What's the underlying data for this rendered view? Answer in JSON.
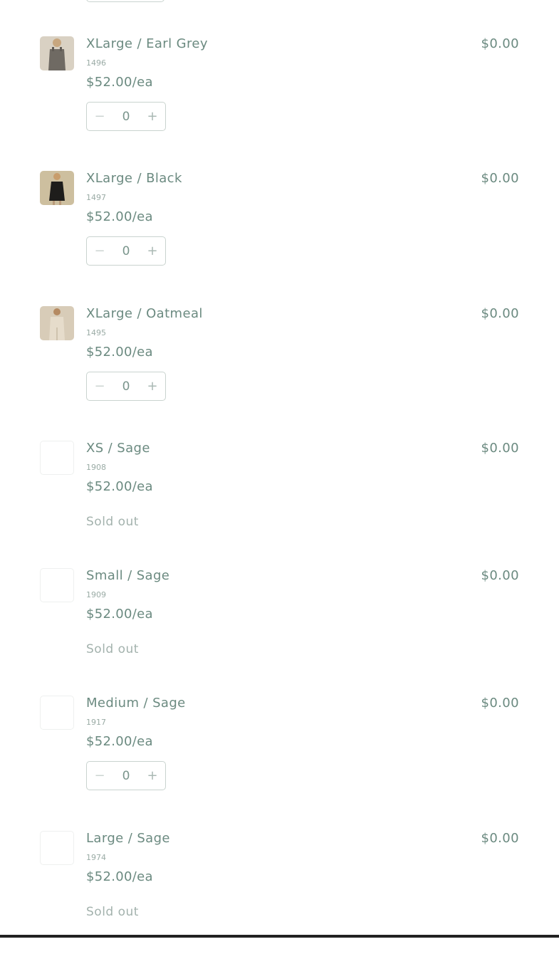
{
  "items": [
    {
      "name": "XLarge / Earl Grey",
      "sku": "1496",
      "unit_price": "$52.00/ea",
      "total": "$0.00",
      "quantity": "0",
      "sold_out": false,
      "thumb": "earl-grey"
    },
    {
      "name": "XLarge / Black",
      "sku": "1497",
      "unit_price": "$52.00/ea",
      "total": "$0.00",
      "quantity": "0",
      "sold_out": false,
      "thumb": "black"
    },
    {
      "name": "XLarge / Oatmeal",
      "sku": "1495",
      "unit_price": "$52.00/ea",
      "total": "$0.00",
      "quantity": "0",
      "sold_out": false,
      "thumb": "oatmeal"
    },
    {
      "name": "XS / Sage",
      "sku": "1908",
      "unit_price": "$52.00/ea",
      "total": "$0.00",
      "sold_out": true,
      "sold_out_label": "Sold out",
      "thumb": "none"
    },
    {
      "name": "Small / Sage",
      "sku": "1909",
      "unit_price": "$52.00/ea",
      "total": "$0.00",
      "sold_out": true,
      "sold_out_label": "Sold out",
      "thumb": "none"
    },
    {
      "name": "Medium / Sage",
      "sku": "1917",
      "unit_price": "$52.00/ea",
      "total": "$0.00",
      "quantity": "0",
      "sold_out": false,
      "thumb": "none"
    },
    {
      "name": "Large / Sage",
      "sku": "1974",
      "unit_price": "$52.00/ea",
      "total": "$0.00",
      "sold_out": true,
      "sold_out_label": "Sold out",
      "thumb": "none"
    }
  ],
  "stepper": {
    "minus_icon": "minus-icon",
    "plus_icon": "plus-icon"
  },
  "colors": {
    "text": "#6b8a80",
    "muted": "#a3b2ad",
    "border": "#c9d3cf"
  }
}
